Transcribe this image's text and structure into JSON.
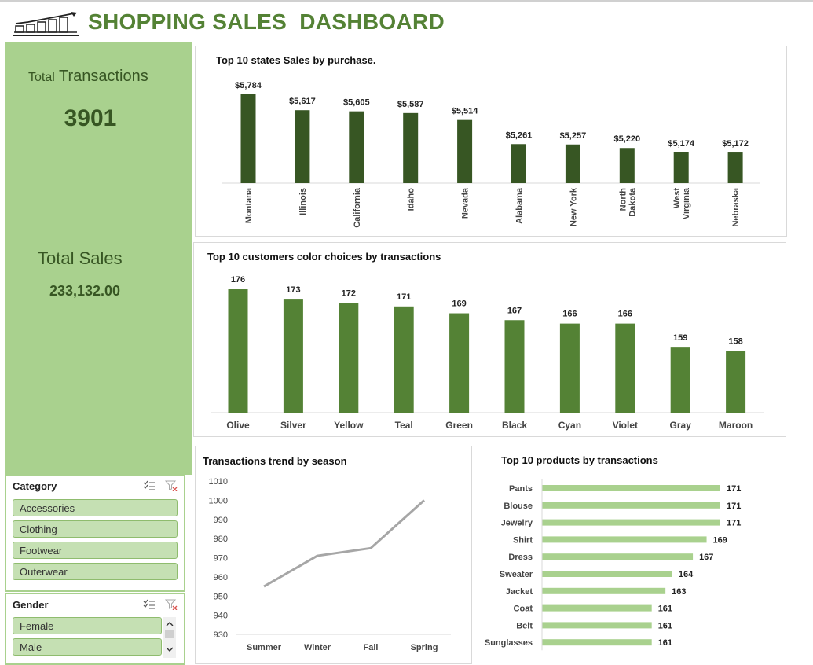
{
  "header": {
    "title": "SHOPPING SALES  DASHBOARD",
    "logo_icon": "growth-bar-chart-icon"
  },
  "kpis": {
    "transactions_label_small": "Total",
    "transactions_label": " Transactions",
    "transactions_value": "3901",
    "sales_label": "Total Sales",
    "sales_value": "233,132.00"
  },
  "colors": {
    "dark_green": "#375623",
    "mid_green": "#548235",
    "light_green": "#a9d18e",
    "bar_light": "#a9d18e",
    "line_gray": "#a6a6a6"
  },
  "charts": {
    "states": {
      "type": "bar",
      "title": "Top 10 states Sales by purchase.",
      "categories": [
        "Montana",
        "Illinois",
        "California",
        "Idaho",
        "Nevada",
        "Alabama",
        "New York",
        "North Dakota",
        "West Virginia",
        "Nebraska"
      ],
      "category_lines": [
        [
          "Montana"
        ],
        [
          "Illinois"
        ],
        [
          "California"
        ],
        [
          "Idaho"
        ],
        [
          "Nevada"
        ],
        [
          "Alabama"
        ],
        [
          "New York"
        ],
        [
          "North",
          "Dakota"
        ],
        [
          "West",
          "Virginia"
        ],
        [
          "Nebraska"
        ]
      ],
      "values": [
        5784,
        5617,
        5605,
        5587,
        5514,
        5261,
        5257,
        5220,
        5174,
        5172
      ],
      "labels": [
        "$5,784",
        "$5,617",
        "$5,605",
        "$5,587",
        "$5,514",
        "$5,261",
        "$5,257",
        "$5,220",
        "$5,174",
        "$5,172"
      ],
      "color": "#375623"
    },
    "colors": {
      "type": "bar",
      "title": "Top 10 customers color choices by  transactions",
      "categories": [
        "Olive",
        "Silver",
        "Yellow",
        "Teal",
        "Green",
        "Black",
        "Cyan",
        "Violet",
        "Gray",
        "Maroon"
      ],
      "values": [
        176,
        173,
        172,
        171,
        169,
        167,
        166,
        166,
        159,
        158
      ],
      "color": "#548235"
    },
    "season": {
      "type": "line",
      "title": "Transactions trend by season",
      "x": [
        "Summer",
        "Winter",
        "Fall",
        "Spring"
      ],
      "y": [
        955,
        971,
        975,
        1000
      ],
      "ylim": [
        930,
        1010
      ],
      "yticks": [
        "1010",
        "1000",
        "990",
        "980",
        "970",
        "960",
        "950",
        "940",
        "930"
      ],
      "color": "#a6a6a6"
    },
    "products": {
      "type": "bar",
      "orientation": "horizontal",
      "title": "Top 10 products by transactions",
      "categories": [
        "Pants",
        "Blouse",
        "Jewelry",
        "Shirt",
        "Dress",
        "Sweater",
        "Jacket",
        "Coat",
        "Belt",
        "Sunglasses"
      ],
      "values": [
        171,
        171,
        171,
        169,
        167,
        164,
        163,
        161,
        161,
        161
      ],
      "color": "#a9d18e"
    }
  },
  "chart_data": [
    {
      "type": "bar",
      "title": "Top 10 states Sales by purchase.",
      "categories": [
        "Montana",
        "Illinois",
        "California",
        "Idaho",
        "Nevada",
        "Alabama",
        "New York",
        "North Dakota",
        "West Virginia",
        "Nebraska"
      ],
      "values": [
        5784,
        5617,
        5605,
        5587,
        5514,
        5261,
        5257,
        5220,
        5174,
        5172
      ]
    },
    {
      "type": "bar",
      "title": "Top 10 customers color choices by  transactions",
      "categories": [
        "Olive",
        "Silver",
        "Yellow",
        "Teal",
        "Green",
        "Black",
        "Cyan",
        "Violet",
        "Gray",
        "Maroon"
      ],
      "values": [
        176,
        173,
        172,
        171,
        169,
        167,
        166,
        166,
        159,
        158
      ]
    },
    {
      "type": "line",
      "title": "Transactions trend by season",
      "x": [
        "Summer",
        "Winter",
        "Fall",
        "Spring"
      ],
      "y": [
        955,
        971,
        975,
        1000
      ],
      "ylim": [
        930,
        1010
      ]
    },
    {
      "type": "bar",
      "title": "Top 10 products by transactions",
      "categories": [
        "Pants",
        "Blouse",
        "Jewelry",
        "Shirt",
        "Dress",
        "Sweater",
        "Jacket",
        "Coat",
        "Belt",
        "Sunglasses"
      ],
      "values": [
        171,
        171,
        171,
        169,
        167,
        164,
        163,
        161,
        161,
        161
      ]
    }
  ],
  "slicers": {
    "category": {
      "header": "Category",
      "items": [
        "Accessories",
        "Clothing",
        "Footwear",
        "Outerwear"
      ],
      "icons": [
        "multi-select-icon",
        "clear-filter-icon"
      ]
    },
    "gender": {
      "header": "Gender",
      "items": [
        "Female",
        "Male"
      ],
      "icons": [
        "multi-select-icon",
        "clear-filter-icon"
      ]
    }
  }
}
